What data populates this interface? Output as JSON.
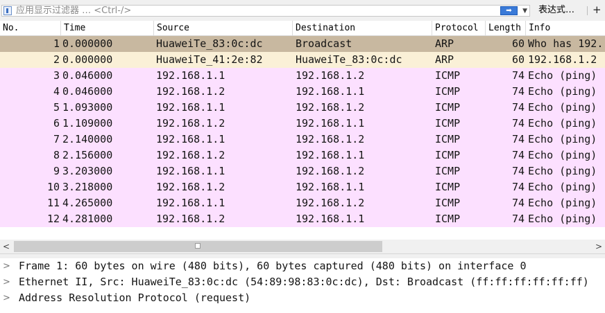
{
  "filter": {
    "placeholder": "应用显示过滤器 … <Ctrl-/>",
    "apply_icon": "arrow-right-icon",
    "dropdown_icon": "chevron-down-icon",
    "expression_label": "表达式…",
    "add_label": "+"
  },
  "columns": [
    "No.",
    "Time",
    "Source",
    "Destination",
    "Protocol",
    "Length",
    "Info"
  ],
  "packets": [
    {
      "no": "1",
      "time": "0.000000",
      "source": "HuaweiTe_83:0c:dc",
      "destination": "Broadcast",
      "protocol": "ARP",
      "length": "60",
      "info": "Who has 192.",
      "color": "#c8b8a0"
    },
    {
      "no": "2",
      "time": "0.000000",
      "source": "HuaweiTe_41:2e:82",
      "destination": "HuaweiTe_83:0c:dc",
      "protocol": "ARP",
      "length": "60",
      "info": "192.168.1.2",
      "color": "#faf0d7"
    },
    {
      "no": "3",
      "time": "0.046000",
      "source": "192.168.1.1",
      "destination": "192.168.1.2",
      "protocol": "ICMP",
      "length": "74",
      "info": "Echo (ping)",
      "color": "#fce0ff"
    },
    {
      "no": "4",
      "time": "0.046000",
      "source": "192.168.1.2",
      "destination": "192.168.1.1",
      "protocol": "ICMP",
      "length": "74",
      "info": "Echo (ping)",
      "color": "#fce0ff"
    },
    {
      "no": "5",
      "time": "1.093000",
      "source": "192.168.1.1",
      "destination": "192.168.1.2",
      "protocol": "ICMP",
      "length": "74",
      "info": "Echo (ping)",
      "color": "#fce0ff"
    },
    {
      "no": "6",
      "time": "1.109000",
      "source": "192.168.1.2",
      "destination": "192.168.1.1",
      "protocol": "ICMP",
      "length": "74",
      "info": "Echo (ping)",
      "color": "#fce0ff"
    },
    {
      "no": "7",
      "time": "2.140000",
      "source": "192.168.1.1",
      "destination": "192.168.1.2",
      "protocol": "ICMP",
      "length": "74",
      "info": "Echo (ping)",
      "color": "#fce0ff"
    },
    {
      "no": "8",
      "time": "2.156000",
      "source": "192.168.1.2",
      "destination": "192.168.1.1",
      "protocol": "ICMP",
      "length": "74",
      "info": "Echo (ping)",
      "color": "#fce0ff"
    },
    {
      "no": "9",
      "time": "3.203000",
      "source": "192.168.1.1",
      "destination": "192.168.1.2",
      "protocol": "ICMP",
      "length": "74",
      "info": "Echo (ping)",
      "color": "#fce0ff"
    },
    {
      "no": "10",
      "time": "3.218000",
      "source": "192.168.1.2",
      "destination": "192.168.1.1",
      "protocol": "ICMP",
      "length": "74",
      "info": "Echo (ping)",
      "color": "#fce0ff"
    },
    {
      "no": "11",
      "time": "4.265000",
      "source": "192.168.1.1",
      "destination": "192.168.1.2",
      "protocol": "ICMP",
      "length": "74",
      "info": "Echo (ping)",
      "color": "#fce0ff"
    },
    {
      "no": "12",
      "time": "4.281000",
      "source": "192.168.1.2",
      "destination": "192.168.1.1",
      "protocol": "ICMP",
      "length": "74",
      "info": "Echo (ping)",
      "color": "#fce0ff"
    }
  ],
  "scrollbar": {
    "left_icon": "chevron-left-icon",
    "right_icon": "chevron-right-icon"
  },
  "details": [
    {
      "text": "Frame 1: 60 bytes on wire (480 bits), 60 bytes captured (480 bits) on interface 0",
      "icon": "chevron-right-icon"
    },
    {
      "text": "Ethernet II, Src: HuaweiTe_83:0c:dc (54:89:98:83:0c:dc), Dst: Broadcast (ff:ff:ff:ff:ff:ff)",
      "icon": "chevron-right-icon"
    },
    {
      "text": "Address Resolution Protocol (request)",
      "icon": "chevron-right-icon"
    }
  ]
}
